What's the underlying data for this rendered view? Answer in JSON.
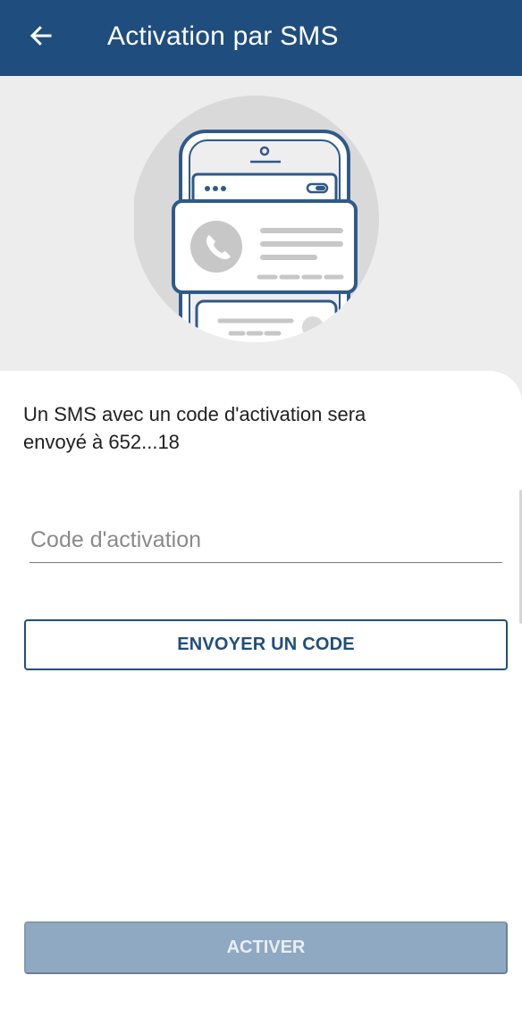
{
  "app_bar": {
    "title": "Activation par SMS",
    "back_icon": "arrow-left-icon",
    "background": "#1f4e7e"
  },
  "hero": {
    "illustration": "phone-contact-card-illustration"
  },
  "content": {
    "info_line1": "Un SMS avec un code d'activation sera",
    "info_line2": "envoyé à 652...18",
    "code_placeholder": "Code d'activation",
    "code_value": "",
    "send_label": "ENVOYER UN CODE",
    "activate_label": "ACTIVER"
  },
  "colors": {
    "primary": "#1f4e7e",
    "disabled_button": "#8fa9c3",
    "screen_background": "#ededed"
  }
}
